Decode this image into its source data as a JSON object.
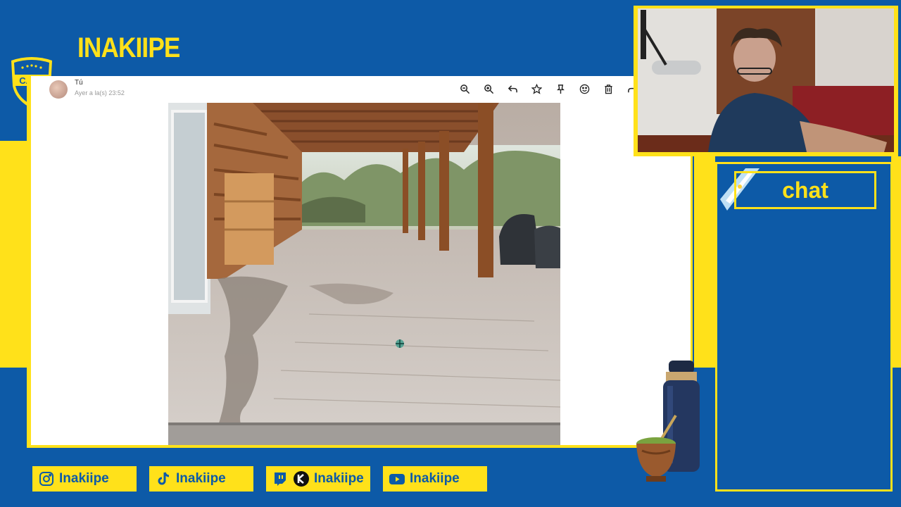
{
  "overlay": {
    "channel_title": "INAKIIPE",
    "badge_text": "CABJ",
    "chat_title": "chat",
    "colors": {
      "blue": "#0d5aa7",
      "yellow": "#ffe11a"
    }
  },
  "viewer": {
    "sender_name": "Tú",
    "sender_time": "Ayer a la(s) 23:52",
    "toolbar": [
      {
        "name": "zoom-out-icon"
      },
      {
        "name": "zoom-in-icon"
      },
      {
        "name": "reply-icon"
      },
      {
        "name": "star-icon"
      },
      {
        "name": "pin-icon"
      },
      {
        "name": "emoji-icon"
      },
      {
        "name": "delete-icon"
      },
      {
        "name": "forward-icon"
      }
    ]
  },
  "socials": [
    {
      "icon": "instagram-icon",
      "label": "Inakiipe"
    },
    {
      "icon": "tiktok-icon",
      "label": "Inakiipe"
    },
    {
      "icon": "twitch-kick-icon",
      "label": "Inakiipe"
    },
    {
      "icon": "youtube-icon",
      "label": "Inakiipe"
    }
  ]
}
